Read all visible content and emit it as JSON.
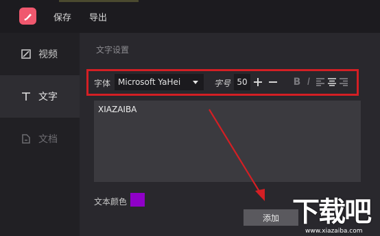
{
  "topbar": {
    "save_label": "保存",
    "export_label": "导出"
  },
  "sidebar": {
    "items": [
      {
        "label": "视频",
        "icon": "video-icon"
      },
      {
        "label": "文字",
        "icon": "text-icon",
        "active": true
      },
      {
        "label": "文档",
        "icon": "document-icon"
      }
    ]
  },
  "main": {
    "section_title": "文字设置",
    "toolbar": {
      "font_label": "字体",
      "font_value": "Microsoft YaHei",
      "size_label": "字号",
      "size_value": "50",
      "bold_label": "B",
      "italic_label": "I"
    },
    "text_content": "XIAZAIBA",
    "color_label": "文本颜色",
    "color_value": "#8f00c8",
    "add_label": "添加"
  },
  "watermark": {
    "text": "下载吧",
    "url": "www.xiazaiba.com"
  },
  "colors": {
    "highlight": "#d41f24",
    "accent": "#f0586e"
  }
}
